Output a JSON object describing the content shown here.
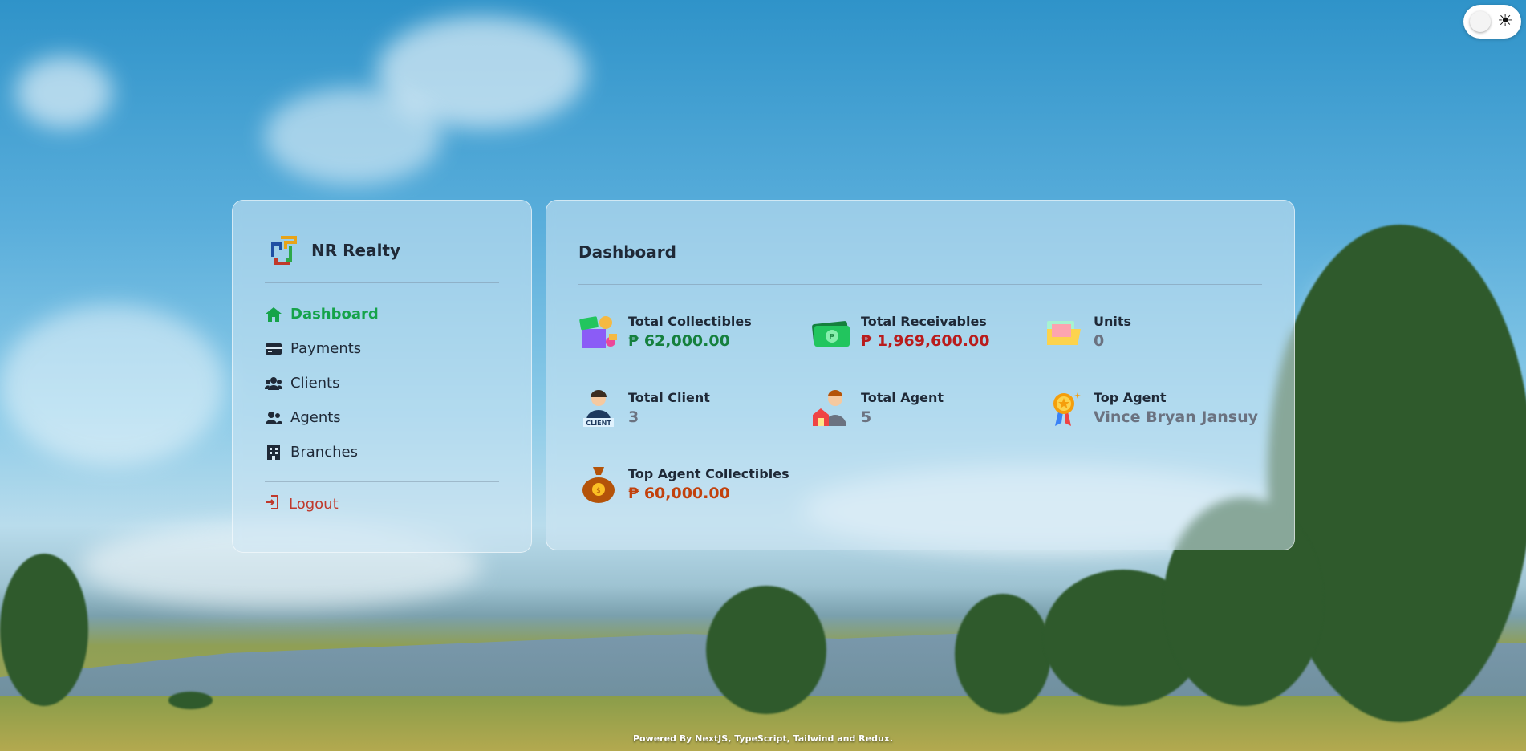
{
  "theme_toggle": {
    "icon": "sun-icon"
  },
  "sidebar": {
    "brand": "NR Realty",
    "items": [
      {
        "label": "Dashboard",
        "icon": "home-icon",
        "active": true
      },
      {
        "label": "Payments",
        "icon": "credit-card-icon"
      },
      {
        "label": "Clients",
        "icon": "users-group-icon"
      },
      {
        "label": "Agents",
        "icon": "user-friends-icon"
      },
      {
        "label": "Branches",
        "icon": "building-icon"
      }
    ],
    "logout": "Logout"
  },
  "main": {
    "title": "Dashboard",
    "stats": [
      {
        "label": "Total Collectibles",
        "value": "₱ 62,000.00",
        "icon": "money-box-icon",
        "color": "#15803d"
      },
      {
        "label": "Total Receivables",
        "value": "₱ 1,969,600.00",
        "icon": "banknotes-icon",
        "color": "#b91c1c"
      },
      {
        "label": "Units",
        "value": "0",
        "icon": "folder-icon",
        "color": "#6b7280"
      },
      {
        "label": "Total Client",
        "value": "3",
        "icon": "client-icon",
        "icon_text": "CLIENT",
        "color": "#6b7280"
      },
      {
        "label": "Total Agent",
        "value": "5",
        "icon": "agent-house-icon",
        "color": "#6b7280"
      },
      {
        "label": "Top Agent",
        "value": "Vince Bryan Jansuy",
        "icon": "award-medal-icon",
        "color": "#6b7280"
      },
      {
        "label": "Top Agent Collectibles",
        "value": "₱ 60,000.00",
        "icon": "money-bag-icon",
        "color": "#c2410c"
      }
    ]
  },
  "footer": "Powered By NextJS, TypeScript, Tailwind and Redux."
}
